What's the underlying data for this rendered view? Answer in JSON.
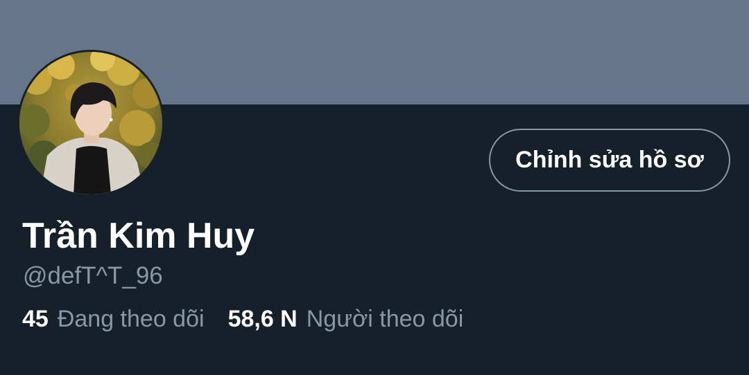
{
  "profile": {
    "display_name": "Trần Kim Huy",
    "handle": "@defT^T_96",
    "edit_button_label": "Chỉnh sửa hồ sơ",
    "avatar_description": "profile photo"
  },
  "stats": [
    {
      "count": "45",
      "label": "Đang theo dõi"
    },
    {
      "count": "58,6 N",
      "label": "Người theo dõi"
    }
  ],
  "colors": {
    "banner": "#66768a",
    "background": "#15202b",
    "primary_text": "#ffffff",
    "secondary_text": "#8899a6",
    "button_border": "#8899a6"
  }
}
